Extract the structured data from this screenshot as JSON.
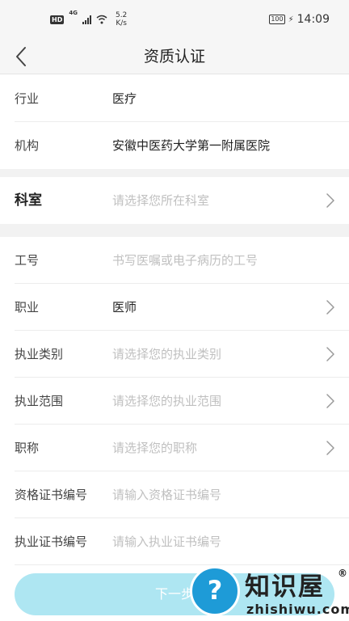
{
  "status_bar": {
    "hd": "HD",
    "network": "4G",
    "speed_value": "5.2",
    "speed_unit": "K/s",
    "battery": "100",
    "time": "14:09"
  },
  "header": {
    "title": "资质认证",
    "back_icon": "chevron-left-icon"
  },
  "fields": [
    {
      "label": "行业",
      "value": "医疗",
      "placeholder": false,
      "chevron": false
    },
    {
      "label": "机构",
      "value": "安徽中医药大学第一附属医院",
      "placeholder": false,
      "chevron": false
    },
    {
      "label": "科室",
      "value": "请选择您所在科室",
      "placeholder": true,
      "chevron": true
    },
    {
      "label": "工号",
      "value": "书写医嘱或电子病历的工号",
      "placeholder": true,
      "chevron": false
    },
    {
      "label": "职业",
      "value": "医师",
      "placeholder": false,
      "chevron": true
    },
    {
      "label": "执业类别",
      "value": "请选择您的执业类别",
      "placeholder": true,
      "chevron": true
    },
    {
      "label": "执业范围",
      "value": "请选择您的执业范围",
      "placeholder": true,
      "chevron": true
    },
    {
      "label": "职称",
      "value": "请选择您的职称",
      "placeholder": true,
      "chevron": true
    },
    {
      "label": "资格证书编号",
      "value": "请输入资格证书编号",
      "placeholder": true,
      "chevron": false
    },
    {
      "label": "执业证书编号",
      "value": "请输入执业证书编号",
      "placeholder": true,
      "chevron": false
    }
  ],
  "footer": {
    "next_label": "下一步"
  },
  "watermark": {
    "symbol": "?",
    "name": "知识屋",
    "registered": "®",
    "url": "zhishiwu.com"
  },
  "colors": {
    "accent": "#aee6f2",
    "placeholder": "#c0c0c0",
    "watermark": "#1e9bd7"
  }
}
